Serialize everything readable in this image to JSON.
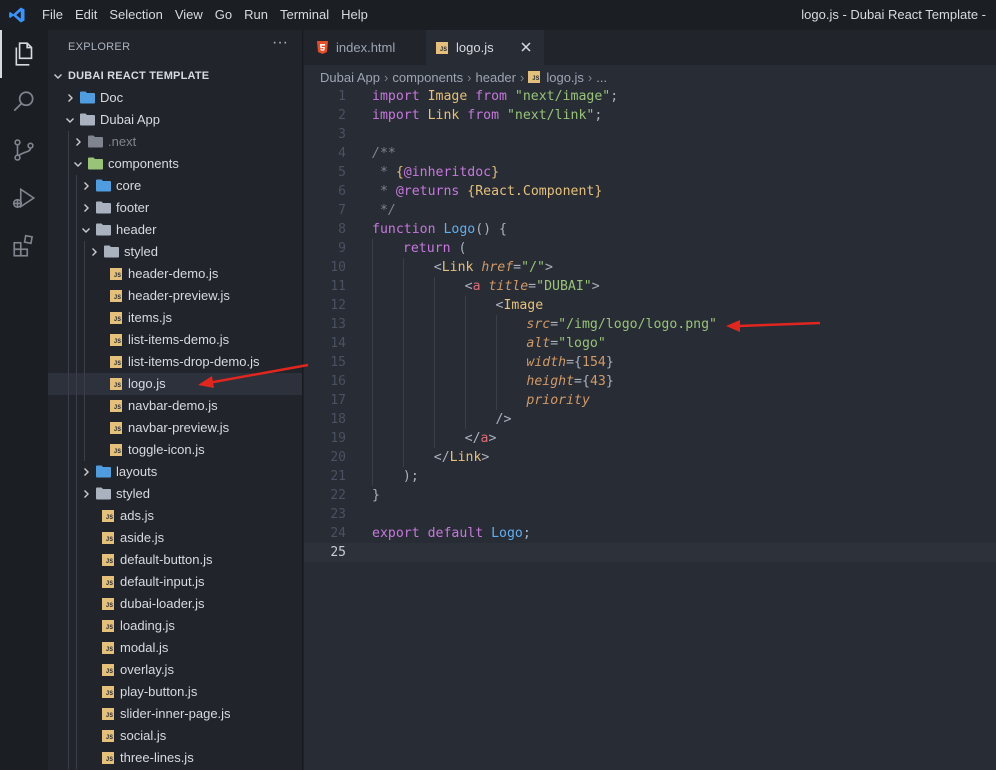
{
  "menu": [
    "File",
    "Edit",
    "Selection",
    "View",
    "Go",
    "Run",
    "Terminal",
    "Help"
  ],
  "window_title": "logo.js - Dubai React Template -",
  "activity": [
    "explorer-icon",
    "search-icon",
    "source-control-icon",
    "run-debug-icon",
    "extensions-icon"
  ],
  "explorer": {
    "title": "EXPLORER",
    "more": "···",
    "root": "DUBAI REACT TEMPLATE",
    "items": [
      {
        "label": "Doc",
        "depth": 0,
        "type": "folder",
        "open": false,
        "color": "#4d9de0"
      },
      {
        "label": "Dubai App",
        "depth": 0,
        "type": "folder",
        "open": true,
        "color": "#aab2bf"
      },
      {
        "label": ".next",
        "depth": 1,
        "type": "folder",
        "open": false,
        "color": "#7f848e",
        "dim": true
      },
      {
        "label": "components",
        "depth": 1,
        "type": "folder",
        "open": true,
        "color": "#98c379"
      },
      {
        "label": "core",
        "depth": 2,
        "type": "folder",
        "open": false,
        "color": "#4d9de0"
      },
      {
        "label": "footer",
        "depth": 2,
        "type": "folder",
        "open": false,
        "color": "#aab2bf"
      },
      {
        "label": "header",
        "depth": 2,
        "type": "folder",
        "open": true,
        "color": "#aab2bf"
      },
      {
        "label": "styled",
        "depth": 3,
        "type": "folder",
        "open": false,
        "color": "#aab2bf"
      },
      {
        "label": "header-demo.js",
        "depth": 3,
        "type": "js"
      },
      {
        "label": "header-preview.js",
        "depth": 3,
        "type": "js"
      },
      {
        "label": "items.js",
        "depth": 3,
        "type": "js"
      },
      {
        "label": "list-items-demo.js",
        "depth": 3,
        "type": "js"
      },
      {
        "label": "list-items-drop-demo.js",
        "depth": 3,
        "type": "js"
      },
      {
        "label": "logo.js",
        "depth": 3,
        "type": "js",
        "selected": true
      },
      {
        "label": "navbar-demo.js",
        "depth": 3,
        "type": "js"
      },
      {
        "label": "navbar-preview.js",
        "depth": 3,
        "type": "js"
      },
      {
        "label": "toggle-icon.js",
        "depth": 3,
        "type": "js"
      },
      {
        "label": "layouts",
        "depth": 2,
        "type": "folder",
        "open": false,
        "color": "#4d9de0"
      },
      {
        "label": "styled",
        "depth": 2,
        "type": "folder",
        "open": false,
        "color": "#aab2bf"
      },
      {
        "label": "ads.js",
        "depth": 2,
        "type": "js"
      },
      {
        "label": "aside.js",
        "depth": 2,
        "type": "js"
      },
      {
        "label": "default-button.js",
        "depth": 2,
        "type": "js"
      },
      {
        "label": "default-input.js",
        "depth": 2,
        "type": "js"
      },
      {
        "label": "dubai-loader.js",
        "depth": 2,
        "type": "js"
      },
      {
        "label": "loading.js",
        "depth": 2,
        "type": "js"
      },
      {
        "label": "modal.js",
        "depth": 2,
        "type": "js"
      },
      {
        "label": "overlay.js",
        "depth": 2,
        "type": "js"
      },
      {
        "label": "play-button.js",
        "depth": 2,
        "type": "js"
      },
      {
        "label": "slider-inner-page.js",
        "depth": 2,
        "type": "js"
      },
      {
        "label": "social.js",
        "depth": 2,
        "type": "js"
      },
      {
        "label": "three-lines.js",
        "depth": 2,
        "type": "js"
      }
    ]
  },
  "tabs": [
    {
      "label": "index.html",
      "active": false
    },
    {
      "label": "logo.js",
      "active": true
    }
  ],
  "breadcrumb": [
    "Dubai App",
    "components",
    "header",
    "logo.js",
    "..."
  ],
  "current_line": 25,
  "code": [
    {
      "n": 1,
      "indent": 0,
      "tokens": [
        [
          "k",
          "import "
        ],
        [
          "t",
          "Image "
        ],
        [
          "k",
          "from "
        ],
        [
          "s",
          "\"next/image\""
        ],
        [
          "p",
          ";"
        ]
      ]
    },
    {
      "n": 2,
      "indent": 0,
      "tokens": [
        [
          "k",
          "import "
        ],
        [
          "t",
          "Link "
        ],
        [
          "k",
          "from "
        ],
        [
          "s",
          "\"next/link\""
        ],
        [
          "p",
          ";"
        ]
      ]
    },
    {
      "n": 3,
      "indent": 0,
      "tokens": []
    },
    {
      "n": 4,
      "indent": 0,
      "tokens": [
        [
          "c",
          "/**"
        ]
      ]
    },
    {
      "n": 5,
      "indent": 0,
      "tokens": [
        [
          "c",
          " * "
        ],
        [
          "t",
          "{"
        ],
        [
          "k",
          "@inheritdoc"
        ],
        [
          "t",
          "}"
        ]
      ]
    },
    {
      "n": 6,
      "indent": 0,
      "tokens": [
        [
          "c",
          " * "
        ],
        [
          "k",
          "@returns "
        ],
        [
          "t",
          "{React.Component}"
        ]
      ]
    },
    {
      "n": 7,
      "indent": 0,
      "tokens": [
        [
          "c",
          " */"
        ]
      ]
    },
    {
      "n": 8,
      "indent": 0,
      "tokens": [
        [
          "k",
          "function "
        ],
        [
          "f",
          "Logo"
        ],
        [
          "p",
          "() {"
        ]
      ]
    },
    {
      "n": 9,
      "indent": 1,
      "tokens": [
        [
          "k",
          "return "
        ],
        [
          "p",
          "("
        ]
      ]
    },
    {
      "n": 10,
      "indent": 2,
      "tokens": [
        [
          "p",
          "<"
        ],
        [
          "t",
          "Link "
        ],
        [
          "a",
          "href"
        ],
        [
          "p",
          "="
        ],
        [
          "s",
          "\"/\""
        ],
        [
          "p",
          ">"
        ]
      ]
    },
    {
      "n": 11,
      "indent": 3,
      "tokens": [
        [
          "p",
          "<"
        ],
        [
          "tg",
          "a "
        ],
        [
          "a",
          "title"
        ],
        [
          "p",
          "="
        ],
        [
          "s",
          "\"DUBAI\""
        ],
        [
          "p",
          ">"
        ]
      ]
    },
    {
      "n": 12,
      "indent": 4,
      "tokens": [
        [
          "p",
          "<"
        ],
        [
          "t",
          "Image"
        ]
      ]
    },
    {
      "n": 13,
      "indent": 5,
      "tokens": [
        [
          "a",
          "src"
        ],
        [
          "p",
          "="
        ],
        [
          "s",
          "\"/img/logo/logo.png\""
        ]
      ]
    },
    {
      "n": 14,
      "indent": 5,
      "tokens": [
        [
          "a",
          "alt"
        ],
        [
          "p",
          "="
        ],
        [
          "s",
          "\"logo\""
        ]
      ]
    },
    {
      "n": 15,
      "indent": 5,
      "tokens": [
        [
          "a",
          "width"
        ],
        [
          "p",
          "="
        ],
        [
          "p",
          "{"
        ],
        [
          "n",
          "154"
        ],
        [
          "p",
          "}"
        ]
      ]
    },
    {
      "n": 16,
      "indent": 5,
      "tokens": [
        [
          "a",
          "height"
        ],
        [
          "p",
          "="
        ],
        [
          "p",
          "{"
        ],
        [
          "n",
          "43"
        ],
        [
          "p",
          "}"
        ]
      ]
    },
    {
      "n": 17,
      "indent": 5,
      "tokens": [
        [
          "a",
          "priority"
        ]
      ]
    },
    {
      "n": 18,
      "indent": 4,
      "tokens": [
        [
          "p",
          "/>"
        ]
      ]
    },
    {
      "n": 19,
      "indent": 3,
      "tokens": [
        [
          "p",
          "</"
        ],
        [
          "tg",
          "a"
        ],
        [
          "p",
          ">"
        ]
      ]
    },
    {
      "n": 20,
      "indent": 2,
      "tokens": [
        [
          "p",
          "</"
        ],
        [
          "t",
          "Link"
        ],
        [
          "p",
          ">"
        ]
      ]
    },
    {
      "n": 21,
      "indent": 1,
      "tokens": [
        [
          "p",
          ");"
        ]
      ]
    },
    {
      "n": 22,
      "indent": 0,
      "tokens": [
        [
          "p",
          "}"
        ]
      ]
    },
    {
      "n": 23,
      "indent": 0,
      "tokens": []
    },
    {
      "n": 24,
      "indent": 0,
      "tokens": [
        [
          "k",
          "export "
        ],
        [
          "k",
          "default "
        ],
        [
          "f",
          "Logo"
        ],
        [
          "p",
          ";"
        ]
      ]
    },
    {
      "n": 25,
      "indent": 0,
      "tokens": []
    }
  ],
  "colors": {
    "arrow": "#e0261f",
    "js_icon": "#e5c07b",
    "html_icon": "#e44d26",
    "accent": "#3794ff"
  }
}
